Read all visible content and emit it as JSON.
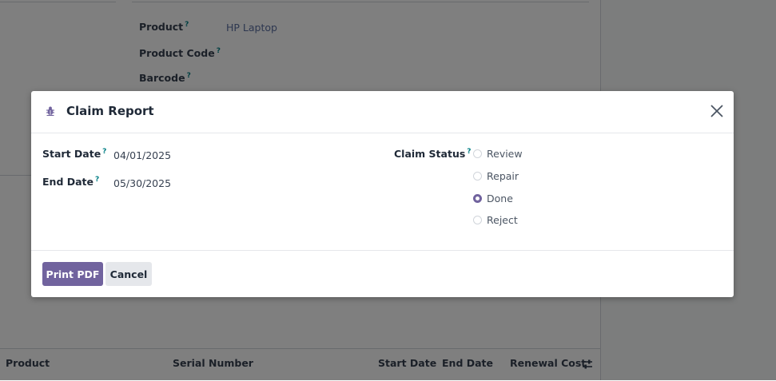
{
  "background": {
    "product_label": "Product",
    "product_value": "HP Laptop",
    "product_code_label": "Product Code",
    "barcode_label": "Barcode",
    "tooltip_marker": "?",
    "list_columns": [
      "Product",
      "Serial Number",
      "Start Date",
      "End Date",
      "Renewal Cost"
    ]
  },
  "dialog": {
    "title": "Claim Report",
    "title_icon": "bug-icon",
    "start_date_label": "Start Date",
    "start_date_value": "04/01/2025",
    "end_date_label": "End Date",
    "end_date_value": "05/30/2025",
    "claim_status_label": "Claim Status",
    "claim_status_options": [
      "Review",
      "Repair",
      "Done",
      "Reject"
    ],
    "claim_status_selected": "Done",
    "print_button": "Print PDF",
    "cancel_button": "Cancel"
  },
  "colors": {
    "primary": "#71639e",
    "link": "#5b6ea0",
    "tooltip": "#017e84"
  }
}
